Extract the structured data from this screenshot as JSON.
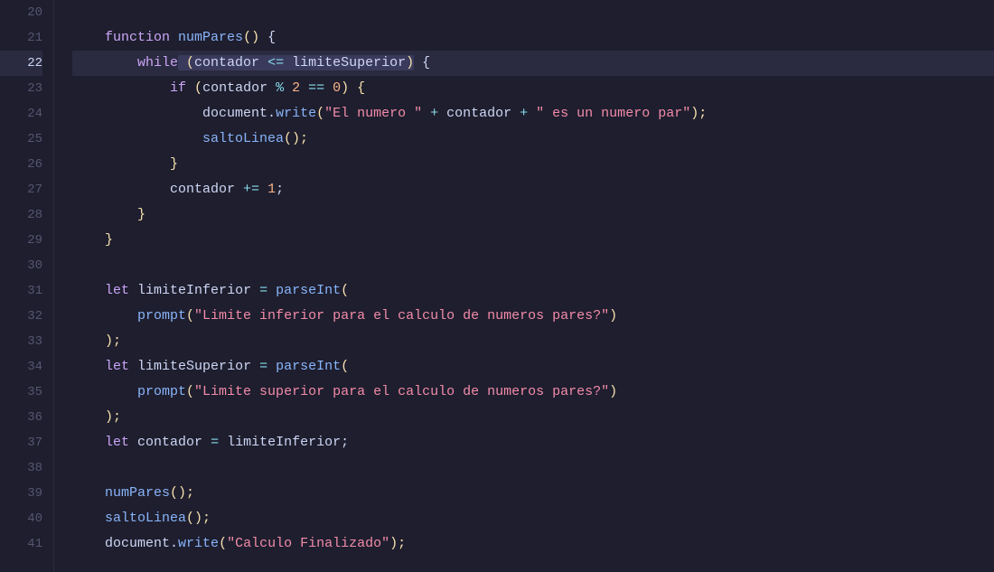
{
  "editor": {
    "background": "#1e1e2e",
    "active_line": 22,
    "lines": [
      {
        "num": 20,
        "content": []
      },
      {
        "num": 21,
        "content": [
          {
            "t": "    ",
            "c": ""
          },
          {
            "t": "function",
            "c": "kw-function"
          },
          {
            "t": " ",
            "c": ""
          },
          {
            "t": "numPares",
            "c": "fn-name"
          },
          {
            "t": "()",
            "c": "paren"
          },
          {
            "t": " {",
            "c": "punct"
          }
        ]
      },
      {
        "num": 22,
        "content": [
          {
            "t": "        ",
            "c": ""
          },
          {
            "t": "while",
            "c": "kw-while"
          },
          {
            "t": " (",
            "c": "paren"
          },
          {
            "t": "contador",
            "c": "var"
          },
          {
            "t": " <= ",
            "c": "operator"
          },
          {
            "t": "limiteSuperior",
            "c": "var"
          },
          {
            "t": ")",
            "c": "paren"
          },
          {
            "t": " {",
            "c": "punct"
          }
        ],
        "active": true
      },
      {
        "num": 23,
        "content": [
          {
            "t": "            ",
            "c": ""
          },
          {
            "t": "if",
            "c": "kw-if"
          },
          {
            "t": " (",
            "c": "paren"
          },
          {
            "t": "contador",
            "c": "var"
          },
          {
            "t": " % ",
            "c": "operator"
          },
          {
            "t": "2",
            "c": "number"
          },
          {
            "t": " == ",
            "c": "operator"
          },
          {
            "t": "0",
            "c": "number"
          },
          {
            "t": ") {",
            "c": "paren"
          }
        ]
      },
      {
        "num": 24,
        "content": [
          {
            "t": "                ",
            "c": ""
          },
          {
            "t": "document",
            "c": "var"
          },
          {
            "t": ".",
            "c": "punct"
          },
          {
            "t": "write",
            "c": "method"
          },
          {
            "t": "(",
            "c": "paren"
          },
          {
            "t": "\"El numero \"",
            "c": "string"
          },
          {
            "t": " + ",
            "c": "operator"
          },
          {
            "t": "contador",
            "c": "var"
          },
          {
            "t": " + ",
            "c": "operator"
          },
          {
            "t": "\" es un numero par\"",
            "c": "string"
          },
          {
            "t": ");",
            "c": "paren"
          }
        ]
      },
      {
        "num": 25,
        "content": [
          {
            "t": "                ",
            "c": ""
          },
          {
            "t": "saltoLinea",
            "c": "fn-name"
          },
          {
            "t": "();",
            "c": "paren"
          }
        ]
      },
      {
        "num": 26,
        "content": [
          {
            "t": "            ",
            "c": ""
          },
          {
            "t": "}",
            "c": "paren"
          }
        ]
      },
      {
        "num": 27,
        "content": [
          {
            "t": "            ",
            "c": ""
          },
          {
            "t": "contador",
            "c": "var"
          },
          {
            "t": " += ",
            "c": "operator"
          },
          {
            "t": "1",
            "c": "number"
          },
          {
            "t": ";",
            "c": "punct"
          }
        ]
      },
      {
        "num": 28,
        "content": [
          {
            "t": "        ",
            "c": ""
          },
          {
            "t": "}",
            "c": "paren"
          }
        ]
      },
      {
        "num": 29,
        "content": [
          {
            "t": "    ",
            "c": ""
          },
          {
            "t": "}",
            "c": "paren"
          }
        ]
      },
      {
        "num": 30,
        "content": []
      },
      {
        "num": 31,
        "content": [
          {
            "t": "    ",
            "c": ""
          },
          {
            "t": "let",
            "c": "kw-let"
          },
          {
            "t": " ",
            "c": ""
          },
          {
            "t": "limiteInferior",
            "c": "var"
          },
          {
            "t": " = ",
            "c": "operator"
          },
          {
            "t": "parseInt",
            "c": "fn-name"
          },
          {
            "t": "(",
            "c": "paren"
          }
        ]
      },
      {
        "num": 32,
        "content": [
          {
            "t": "        ",
            "c": ""
          },
          {
            "t": "prompt",
            "c": "fn-name"
          },
          {
            "t": "(",
            "c": "paren"
          },
          {
            "t": "\"Limite inferior para el calculo de numeros pares?\"",
            "c": "string"
          },
          {
            "t": ")",
            "c": "paren"
          }
        ]
      },
      {
        "num": 33,
        "content": [
          {
            "t": "    ",
            "c": ""
          },
          {
            "t": ");",
            "c": "paren"
          }
        ]
      },
      {
        "num": 34,
        "content": [
          {
            "t": "    ",
            "c": ""
          },
          {
            "t": "let",
            "c": "kw-let"
          },
          {
            "t": " ",
            "c": ""
          },
          {
            "t": "limiteSuperior",
            "c": "var"
          },
          {
            "t": " = ",
            "c": "operator"
          },
          {
            "t": "parseInt",
            "c": "fn-name"
          },
          {
            "t": "(",
            "c": "paren"
          }
        ]
      },
      {
        "num": 35,
        "content": [
          {
            "t": "        ",
            "c": ""
          },
          {
            "t": "prompt",
            "c": "fn-name"
          },
          {
            "t": "(",
            "c": "paren"
          },
          {
            "t": "\"Limite superior para el calculo de numeros pares?\"",
            "c": "string"
          },
          {
            "t": ")",
            "c": "paren"
          }
        ]
      },
      {
        "num": 36,
        "content": [
          {
            "t": "    ",
            "c": ""
          },
          {
            "t": ");",
            "c": "paren"
          }
        ]
      },
      {
        "num": 37,
        "content": [
          {
            "t": "    ",
            "c": ""
          },
          {
            "t": "let",
            "c": "kw-let"
          },
          {
            "t": " ",
            "c": ""
          },
          {
            "t": "contador",
            "c": "var"
          },
          {
            "t": " = ",
            "c": "operator"
          },
          {
            "t": "limiteInferior",
            "c": "var"
          },
          {
            "t": ";",
            "c": "punct"
          }
        ]
      },
      {
        "num": 38,
        "content": []
      },
      {
        "num": 39,
        "content": [
          {
            "t": "    ",
            "c": ""
          },
          {
            "t": "numPares",
            "c": "fn-name"
          },
          {
            "t": "();",
            "c": "paren"
          }
        ]
      },
      {
        "num": 40,
        "content": [
          {
            "t": "    ",
            "c": ""
          },
          {
            "t": "saltoLinea",
            "c": "fn-name"
          },
          {
            "t": "();",
            "c": "paren"
          }
        ]
      },
      {
        "num": 41,
        "content": [
          {
            "t": "    ",
            "c": ""
          },
          {
            "t": "document",
            "c": "var"
          },
          {
            "t": ".",
            "c": "punct"
          },
          {
            "t": "write",
            "c": "method"
          },
          {
            "t": "(",
            "c": "paren"
          },
          {
            "t": "\"Calculo Finalizado\"",
            "c": "string"
          },
          {
            "t": ");",
            "c": "paren"
          }
        ]
      }
    ]
  }
}
